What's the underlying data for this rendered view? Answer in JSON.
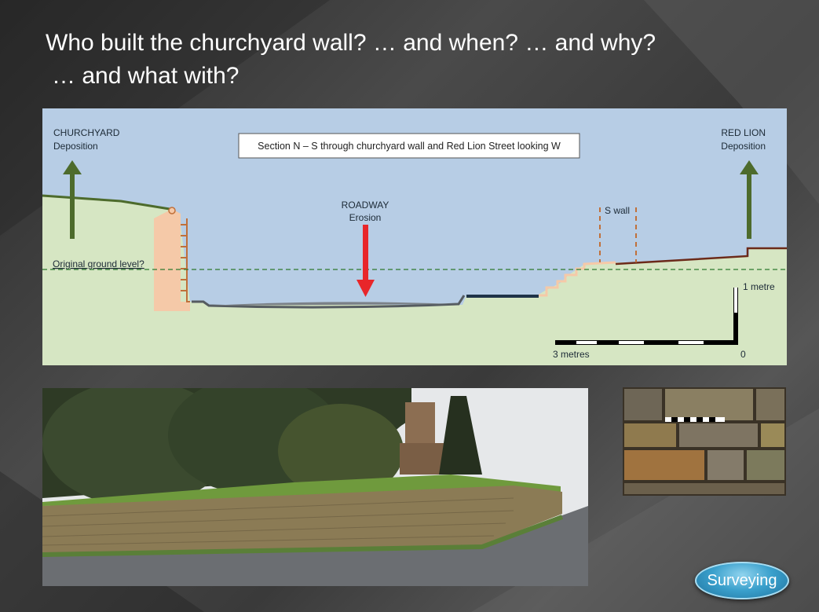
{
  "slide": {
    "title_line1": "Who built the churchyard wall? … and when? … and why?",
    "title_line2": "… and what with?"
  },
  "diagram": {
    "caption": "Section N – S through churchyard wall and Red Lion Street looking W",
    "churchyard_label": "CHURCHYARD",
    "churchyard_sub": "Deposition",
    "redlion_label": "RED LION",
    "redlion_sub": "Deposition",
    "roadway_label": "ROADWAY",
    "roadway_sub": "Erosion",
    "swall_label": "S wall",
    "ground_label": "Original ground level?",
    "scale_vertical_label": "1  metre",
    "scale_horizontal_label": "3  metres",
    "scale_origin_label": "0",
    "colors": {
      "sky": "#b7cde5",
      "ground": "#d6e6c3",
      "wall": "#f5c9a8",
      "arrow_green": "#4d6b2c",
      "arrow_red": "#e8262a"
    }
  },
  "nav": {
    "surveying_label": "Surveying"
  }
}
